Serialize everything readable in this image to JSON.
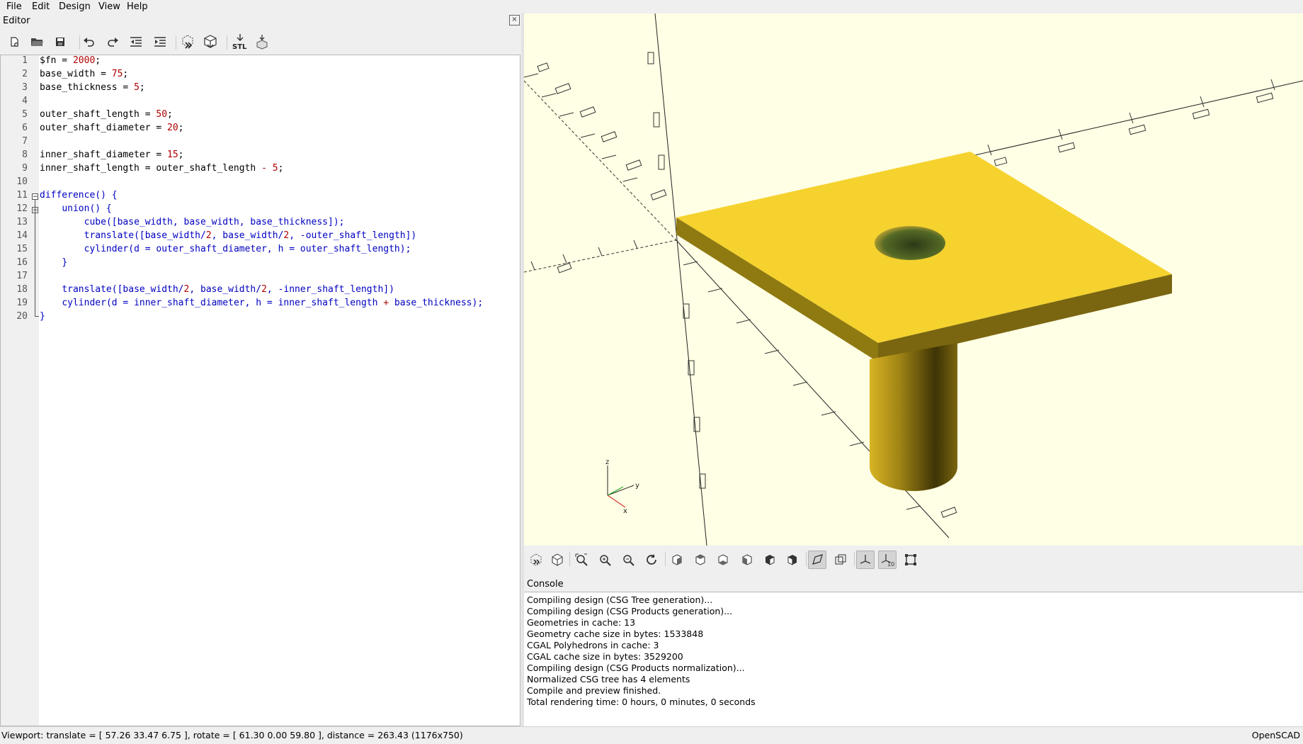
{
  "menu": [
    "File",
    "Edit",
    "Design",
    "View",
    "Help"
  ],
  "editor": {
    "title": "Editor",
    "close_glyph": "×",
    "toolbar_icons": [
      "new-file-icon",
      "open-file-icon",
      "save-icon",
      "undo-icon",
      "redo-icon",
      "unindent-icon",
      "indent-icon",
      "preview-icon",
      "render-icon",
      "export-stl-icon",
      "send-to-printer-icon"
    ],
    "stl_label": "STL",
    "line_numbers": [
      "1",
      "2",
      "3",
      "4",
      "5",
      "6",
      "7",
      "8",
      "9",
      "10",
      "11",
      "12",
      "13",
      "14",
      "15",
      "16",
      "17",
      "18",
      "19",
      "20"
    ],
    "fold_glyph": "−",
    "code": {
      "l1": {
        "a": "$fn = ",
        "n": "2000",
        "z": ";"
      },
      "l2": {
        "a": "base_width = ",
        "n": "75",
        "z": ";"
      },
      "l3": {
        "a": "base_thickness = ",
        "n": "5",
        "z": ";"
      },
      "l5": {
        "a": "outer_shaft_length = ",
        "n": "50",
        "z": ";"
      },
      "l6": {
        "a": "outer_shaft_diameter = ",
        "n": "20",
        "z": ";"
      },
      "l8": {
        "a": "inner_shaft_diameter = ",
        "n": "15",
        "z": ";"
      },
      "l9": {
        "a": "inner_shaft_length = outer_shaft_length ",
        "op": "-",
        "sp": " ",
        "n": "5",
        "z": ";"
      },
      "l11": {
        "k": "difference",
        "a": "() {"
      },
      "l12": {
        "ind": "    ",
        "k": "union",
        "a": "() {"
      },
      "l13": {
        "ind": "        ",
        "k": "cube",
        "a": "([base_width, base_width, base_thickness]);"
      },
      "l14": {
        "ind": "        ",
        "k": "translate",
        "a": "([base_width/",
        "n1": "2",
        "b": ", base_width/",
        "n2": "2",
        "c": ", -outer_shaft_length])"
      },
      "l15": {
        "ind": "        ",
        "k": "cylinder",
        "a": "(d = outer_shaft_diameter, h = outer_shaft_length);"
      },
      "l16": {
        "ind": "    ",
        "a": "}"
      },
      "l18": {
        "ind": "    ",
        "k": "translate",
        "a": "([base_width/",
        "n1": "2",
        "b": ", base_width/",
        "n2": "2",
        "c": ", -inner_shaft_length])"
      },
      "l19": {
        "ind": "    ",
        "k": "cylinder",
        "a": "(d = inner_shaft_diameter, h = inner_shaft_length ",
        "op": "+",
        "c": " base_thickness);"
      },
      "l20": {
        "a": "}"
      }
    }
  },
  "viewport": {
    "model_color": "#f5d22e",
    "background": "#ffffe5",
    "axes_labels": {
      "z": "z",
      "y": "y",
      "x": "x"
    }
  },
  "view_toolbar_icons": [
    "preview-icon",
    "render-icon",
    "view-all-icon",
    "zoom-in-icon",
    "zoom-out-icon",
    "reset-view-icon",
    "view-right-icon",
    "view-top-icon",
    "view-bottom-icon",
    "view-left-icon",
    "view-front-icon",
    "view-back-icon",
    "perspective-icon",
    "orthogonal-icon",
    "show-axes-icon",
    "show-scale-markers-icon",
    "show-edges-icon"
  ],
  "scale_marker_label": "10",
  "console": {
    "title": "Console",
    "lines": [
      "Compiling design (CSG Tree generation)...",
      "Compiling design (CSG Products generation)...",
      "Geometries in cache: 13",
      "Geometry cache size in bytes: 1533848",
      "CGAL Polyhedrons in cache: 3",
      "CGAL cache size in bytes: 3529200",
      "Compiling design (CSG Products normalization)...",
      "Normalized CSG tree has 4 elements",
      "Compile and preview finished.",
      "Total rendering time: 0 hours, 0 minutes, 0 seconds"
    ]
  },
  "status": {
    "viewport_info": "Viewport: translate = [ 57.26 33.47 6.75 ], rotate = [ 61.30 0.00 59.80 ], distance = 263.43 (1176x750)",
    "app_name": "OpenSCAD"
  }
}
